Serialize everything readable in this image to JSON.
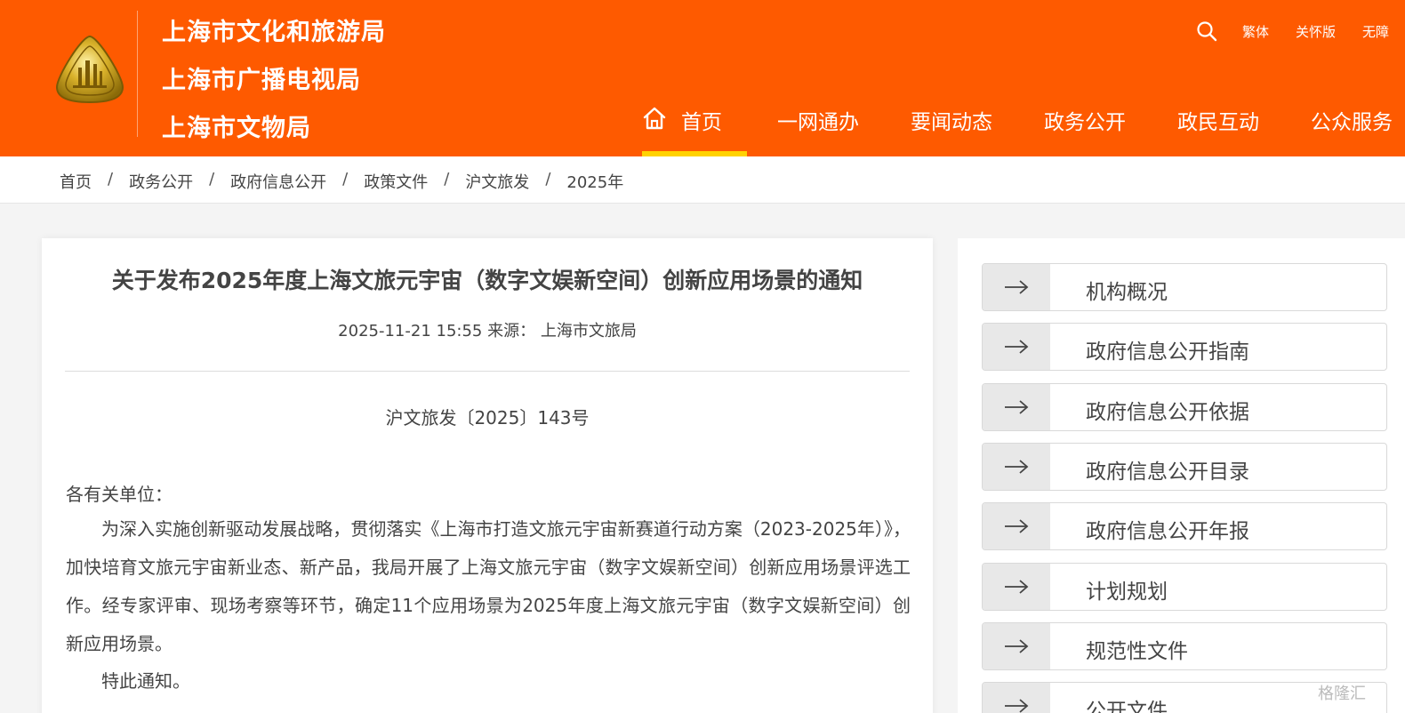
{
  "header": {
    "org_names": [
      "上海市文化和旅游局",
      "上海市广播电视局",
      "上海市文物局"
    ],
    "tools": [
      "繁体",
      "关怀版",
      "无障"
    ],
    "nav": [
      {
        "label": "首页",
        "active": true
      },
      {
        "label": "一网通办"
      },
      {
        "label": "要闻动态"
      },
      {
        "label": "政务公开"
      },
      {
        "label": "政民互动"
      },
      {
        "label": "公众服务"
      }
    ]
  },
  "breadcrumb": [
    "首页",
    "政务公开",
    "政府信息公开",
    "政策文件",
    "沪文旅发",
    "2025年"
  ],
  "breadcrumb_separator": "/",
  "article": {
    "title": "关于发布2025年度上海文旅元宇宙（数字文娱新空间）创新应用场景的通知",
    "meta": "2025-11-21 15:55 来源：  上海市文旅局",
    "doc_number": "沪文旅发〔2025〕143号",
    "greeting": "各有关单位：",
    "paragraph": "为深入实施创新驱动发展战略，贯彻落实《上海市打造文旅元宇宙新赛道行动方案（2023-2025年）》，加快培育文旅元宇宙新业态、新产品，我局开展了上海文旅元宇宙（数字文娱新空间）创新应用场景评选工作。经专家评审、现场考察等环节，确定11个应用场景为2025年度上海文旅元宇宙（数字文娱新空间）创新应用场景。",
    "closing": "特此通知。"
  },
  "sidebar": {
    "items": [
      "机构概况",
      "政府信息公开指南",
      "政府信息公开依据",
      "政府信息公开目录",
      "政府信息公开年报",
      "计划规划",
      "规范性文件",
      "公开文件"
    ]
  },
  "watermark": "格隆汇",
  "colors": {
    "brand": "#fe5a00",
    "nav_active_underline": "#ffd200",
    "logo_gold": "#c9a21c"
  },
  "icons": {
    "search": "search-icon",
    "home": "home-icon",
    "arrow": "arrow-right-icon"
  }
}
